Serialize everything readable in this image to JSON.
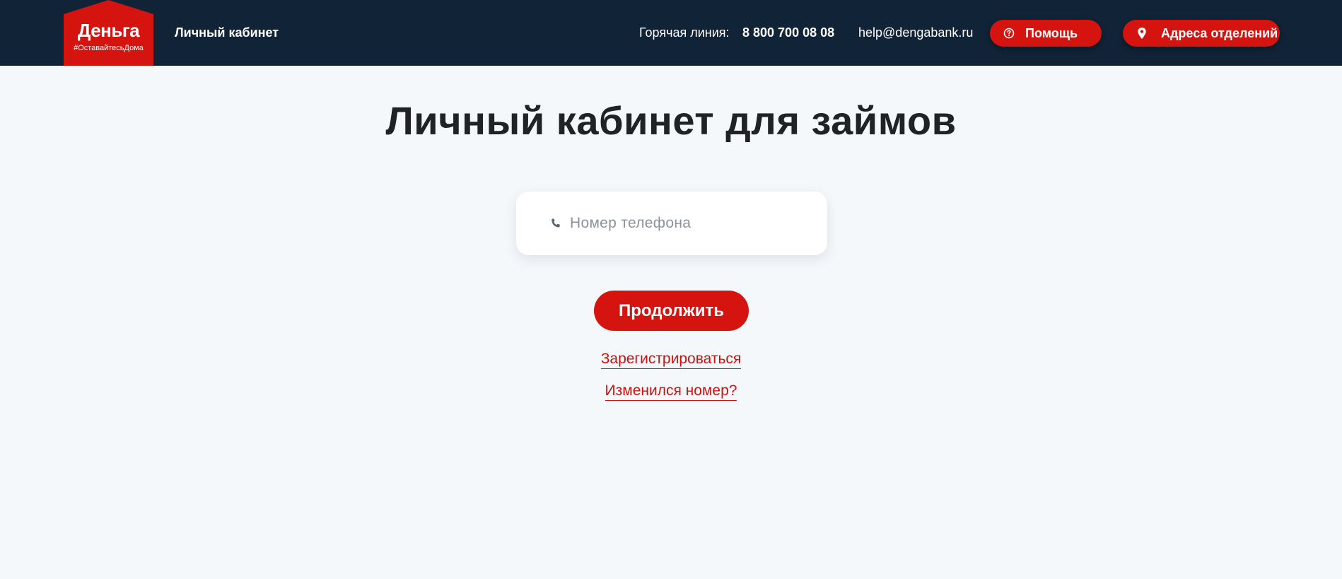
{
  "header": {
    "logo": {
      "title": "Деньга",
      "tagline": "#ОставайтесьДома",
      "color": "#d5130f"
    },
    "cabinet_link": "Личный кабинет",
    "hotline_label": "Горячая линия:",
    "hotline_phone": "8 800 700 08 08",
    "email": "help@dengabank.ru",
    "help_button": {
      "label": "Помощь",
      "icon": "help-circle-icon"
    },
    "address_button": {
      "label": "Адреса отделений",
      "icon": "map-pin-icon"
    },
    "background": "#112337"
  },
  "main": {
    "title": "Личный кабинет для займов",
    "phone_field": {
      "placeholder": "Номер телефона",
      "value": "",
      "icon": "phone-icon"
    },
    "continue_button": "Продолжить",
    "register_link": "Зарегистрироваться",
    "changed_number_link": "Изменился номер?",
    "accent_color": "#d5130f",
    "background": "#f5f8fb"
  }
}
